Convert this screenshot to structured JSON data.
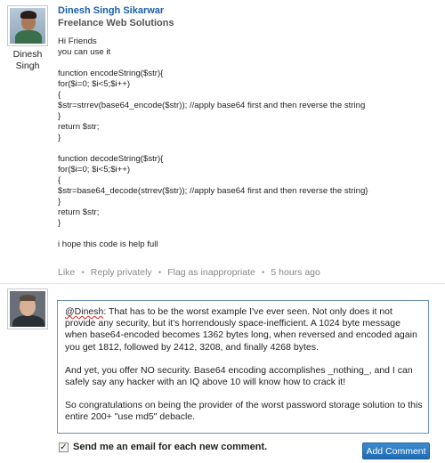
{
  "post": {
    "author_name": "Dinesh Singh Sikarwar",
    "author_tagline": "Freelance Web Solutions",
    "author_under_avatar": [
      "Dinesh",
      "Singh"
    ],
    "body_lines": [
      "Hi Friends",
      "you can use it",
      "",
      "function encodeString($str){",
      "for($i=0; $i<5;$i++)",
      "{",
      "$str=strrev(base64_encode($str)); //apply base64 first and then reverse the string",
      "}",
      "return $str;",
      "}",
      "",
      "function decodeString($str){",
      "for($i=0; $i<5;$i++)",
      "{",
      "$str=base64_decode(strrev($str)); //apply base64 first and then reverse the string}",
      "}",
      "return $str;",
      "}",
      "",
      "i hope this code is help full"
    ],
    "meta": {
      "like": "Like",
      "reply": "Reply privately",
      "flag": "Flag as inappropriate",
      "time": "5 hours ago",
      "separator": "•"
    }
  },
  "reply": {
    "paragraphs": [
      {
        "mention": "@Dinesh",
        "text": ": That has to be the worst example I've ever seen. Not only does it not provide any security, but it's horrendously space-inefficient. A 1024 byte message when base64-encoded becomes 1362 bytes long, when reversed and encoded again you get 1812, followed by 2412, 3208, and finally 4268 bytes."
      },
      {
        "mention": "",
        "text": "And yet, you offer NO security. Base64 encoding accomplishes _nothing_, and I can safely say any hacker with an IQ above 10 will know how to crack it!"
      },
      {
        "mention": "",
        "text": "So congratulations on being the provider of the worst password storage solution to this entire 200+ \"use md5\" debacle."
      }
    ],
    "email_checkbox_label": "Send me an email for each new comment.",
    "email_checked": true,
    "check_glyph": "✓",
    "submit_label": "Add Comment"
  },
  "colors": {
    "link_blue": "#1a5fa8",
    "button_blue": "#2a7bc4",
    "meta_gray": "#888888"
  }
}
